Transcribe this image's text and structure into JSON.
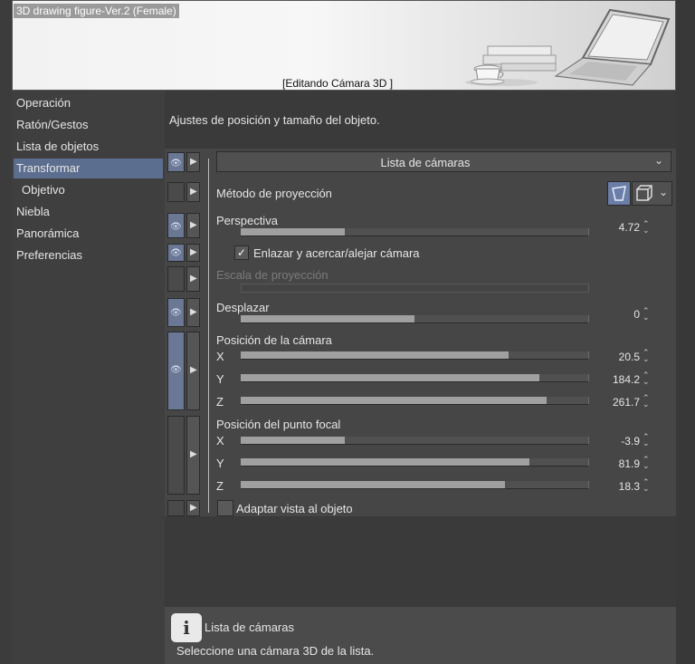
{
  "preview": {
    "title": "3D drawing figure-Ver.2 (Female)",
    "caption": "[Editando Cámara 3D ]"
  },
  "sidebar": {
    "items": [
      {
        "label": "Operación"
      },
      {
        "label": "Ratón/Gestos"
      },
      {
        "label": "Lista de objetos"
      },
      {
        "label": "Transformar"
      },
      {
        "label": "Objetivo"
      },
      {
        "label": "Niebla"
      },
      {
        "label": "Panorámica"
      },
      {
        "label": "Preferencias"
      }
    ],
    "selected": "Transformar"
  },
  "main": {
    "description": "Ajustes de posición y tamaño del objeto.",
    "camera_list": {
      "value": "Lista de cámaras",
      "icon": "chevron-down-icon"
    },
    "projection": {
      "label": "Método de proyección"
    },
    "perspective": {
      "label": "Perspectiva",
      "value": "4.72",
      "level": 0.3
    },
    "link_zoom": {
      "label": "Enlazar y acercar/alejar cámara",
      "checked": true
    },
    "projection_scale": {
      "label": "Escala de proyección"
    },
    "shift": {
      "label": "Desplazar",
      "value": "0",
      "level": 0.5
    },
    "camera_position": {
      "label": "Posición de la cámara",
      "x": {
        "label": "X",
        "value": "20.5",
        "level": 0.77
      },
      "y": {
        "label": "Y",
        "value": "184.2",
        "level": 0.86
      },
      "z": {
        "label": "Z",
        "value": "261.7",
        "level": 0.88
      }
    },
    "focal_point": {
      "label": "Posición del punto focal",
      "x": {
        "label": "X",
        "value": "-3.9",
        "level": 0.3
      },
      "y": {
        "label": "Y",
        "value": "81.9",
        "level": 0.83
      },
      "z": {
        "label": "Z",
        "value": "18.3",
        "level": 0.76
      }
    },
    "fit_view": {
      "label": "Adaptar vista al objeto",
      "checked": false
    }
  },
  "help": {
    "title": "Lista de cámaras",
    "text": "Seleccione una cámara 3D de la lista."
  },
  "colors": {
    "accent": "#5c6e8f",
    "eye_on": "#6a7896"
  }
}
